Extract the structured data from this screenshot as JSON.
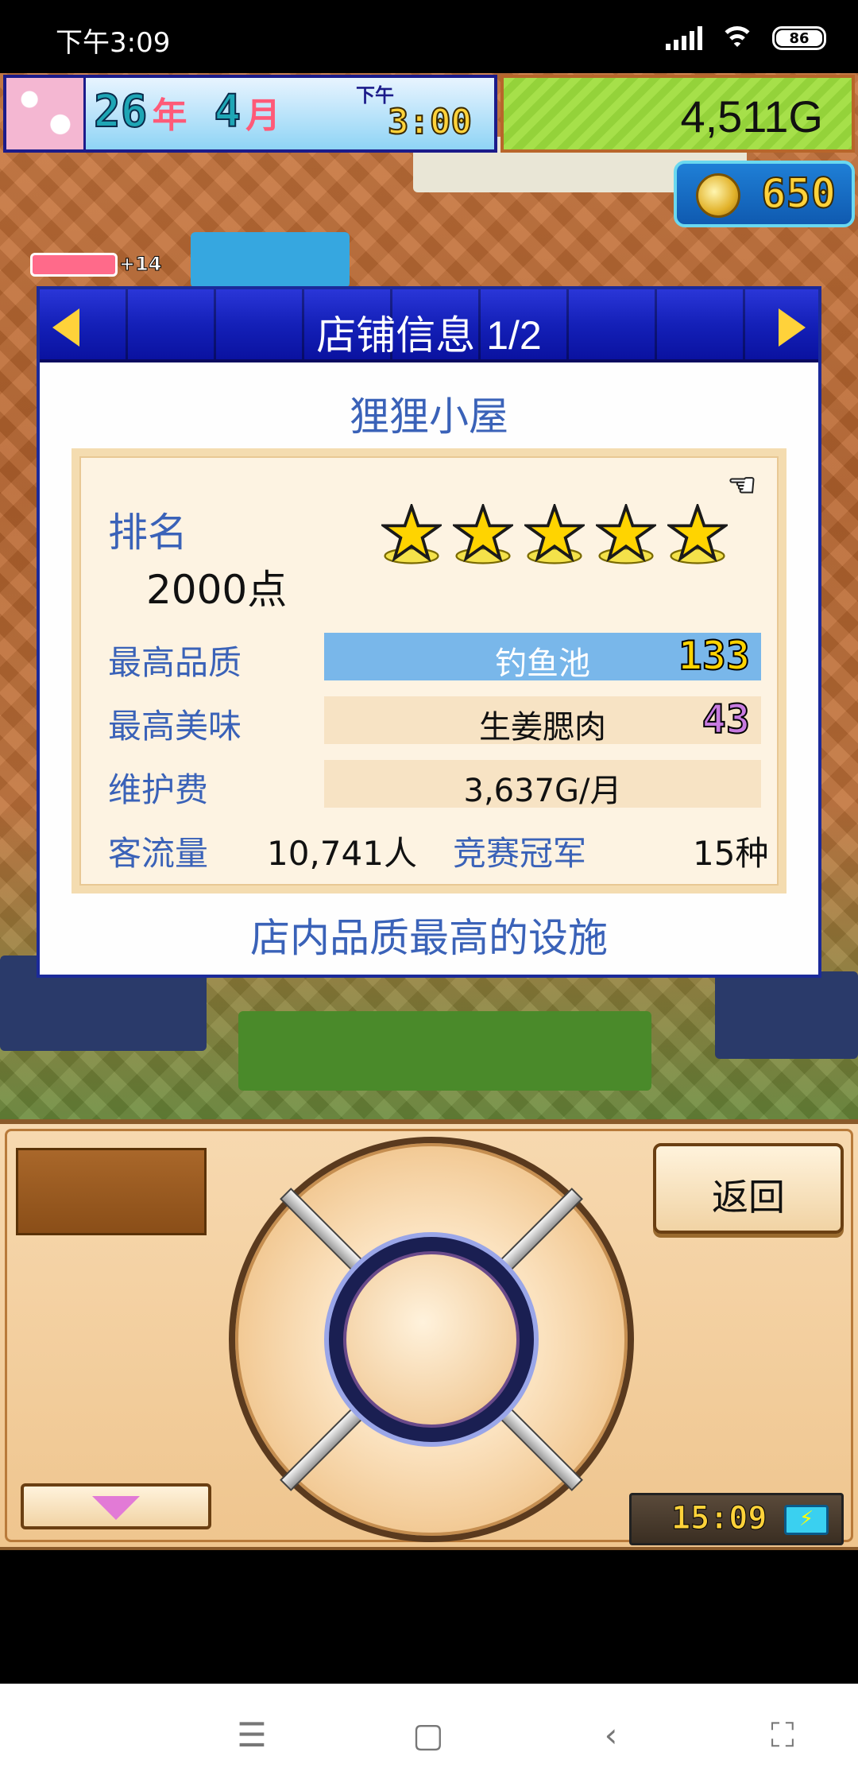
{
  "status_bar": {
    "time": "下午3:09",
    "battery": "86"
  },
  "hud": {
    "year_num": "26",
    "year_unit": "年",
    "month_num": "4",
    "month_unit": "月",
    "ampm": "下午",
    "clock": "3:00",
    "money": "4,511G",
    "coins": "650",
    "side_gauge_plus": "+14"
  },
  "dialog": {
    "title": "店铺信息 1/2",
    "shop_name": "狸狸小屋",
    "rank_label": "排名",
    "rank_points": "2000点",
    "stars": 5,
    "rows": {
      "quality_label": "最高品质",
      "quality_value": "钓鱼池",
      "quality_badge": "133",
      "taste_label": "最高美味",
      "taste_value": "生姜腮肉",
      "taste_badge": "43",
      "upkeep_label": "维护费",
      "upkeep_value": "3,637G/月",
      "traffic_label": "客流量",
      "traffic_value": "10,741人",
      "contest_label": "竞赛冠军",
      "contest_value": "15种"
    },
    "footer": "店内品质最高的设施"
  },
  "controller": {
    "back_label": "返回",
    "device_time": "15:09"
  },
  "colors": {
    "dialog_header": "#1420b8",
    "label_blue": "#3a62b8",
    "highlight_row": "#79b7ea",
    "row_bg": "#f7e3c4"
  }
}
